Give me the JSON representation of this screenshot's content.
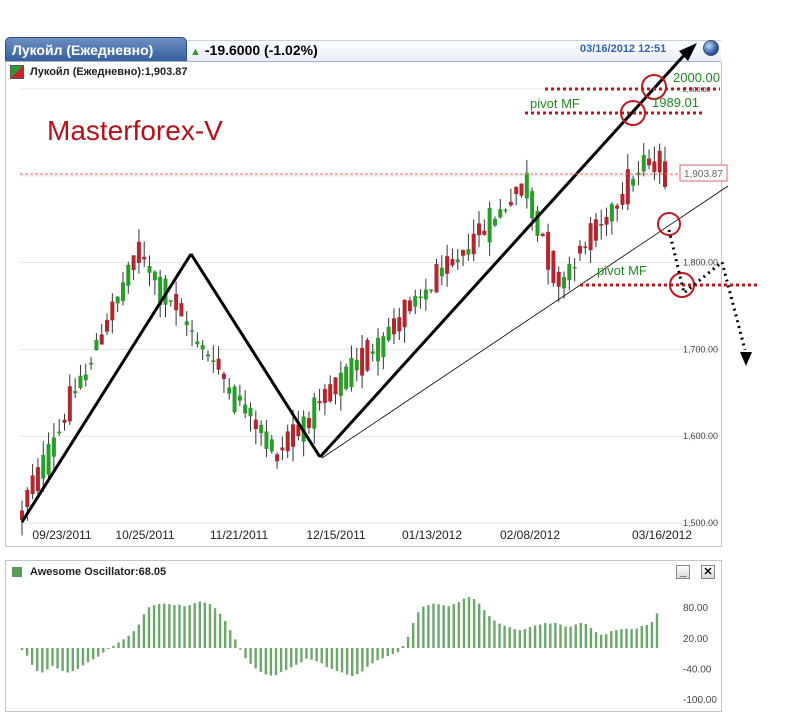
{
  "header": {
    "tab_label": "Лукойл (Ежедневно)",
    "change": "-19.6000 (-1.02%)",
    "datetime": "03/16/2012 12:51"
  },
  "series_title": "Лукойл (Ежедневно):1,903.87",
  "indicator_title": "Awesome Oscillator:68.05",
  "watermark": "Masterforex-V",
  "colors": {
    "up": "#2a9c2a",
    "down": "#b3262e",
    "osc": "#6aa86a",
    "annot_red": "#c0171c",
    "annot_green": "#1e8a1e"
  },
  "chart_data": [
    {
      "type": "candlestick",
      "x_ticks": [
        "09/23/2011",
        "10/25/2011",
        "11/21/2011",
        "12/15/2011",
        "01/13/2012",
        "02/08/2012",
        "03/16/2012"
      ],
      "ylim": [
        1500,
        2000
      ],
      "y_ticks": [
        "1,500.00",
        "1,600.00",
        "1,700.00",
        "1,800.00",
        "2,000.00"
      ],
      "last_price": "1,903.87",
      "bars": 122,
      "annotations": {
        "levels": [
          "2000.00",
          "1989.01"
        ],
        "pivot_label_1": "pivot MF",
        "pivot_label_2": "pivot MF"
      }
    },
    {
      "type": "bar",
      "name": "Awesome Oscillator",
      "ylim": [
        -100,
        100
      ],
      "y_ticks": [
        "80.00",
        "20.00",
        "-40.00",
        "-100.00"
      ],
      "values": [
        -4,
        -15,
        -33,
        -45,
        -48,
        -42,
        -35,
        -40,
        -45,
        -48,
        -45,
        -41,
        -34,
        -28,
        -22,
        -17,
        -9,
        -2,
        4,
        11,
        17,
        24,
        33,
        46,
        66,
        80,
        84,
        86,
        87,
        86,
        84,
        85,
        82,
        84,
        88,
        91,
        89,
        86,
        78,
        67,
        53,
        35,
        17,
        -3,
        -20,
        -31,
        -40,
        -47,
        -52,
        -54,
        -53,
        -47,
        -43,
        -38,
        -33,
        -28,
        -21,
        -23,
        -26,
        -30,
        -37,
        -41,
        -45,
        -48,
        -52,
        -55,
        -51,
        -46,
        -37,
        -30,
        -24,
        -20,
        -16,
        -12,
        -8,
        4,
        22,
        49,
        70,
        81,
        84,
        87,
        86,
        84,
        82,
        86,
        90,
        97,
        100,
        96,
        87,
        74,
        63,
        54,
        48,
        44,
        41,
        37,
        35,
        37,
        41,
        44,
        46,
        49,
        48,
        49,
        46,
        42,
        42,
        46,
        49,
        47,
        39,
        31,
        26,
        27,
        33,
        35,
        37,
        38,
        37,
        38,
        43,
        45,
        51,
        68
      ]
    }
  ]
}
